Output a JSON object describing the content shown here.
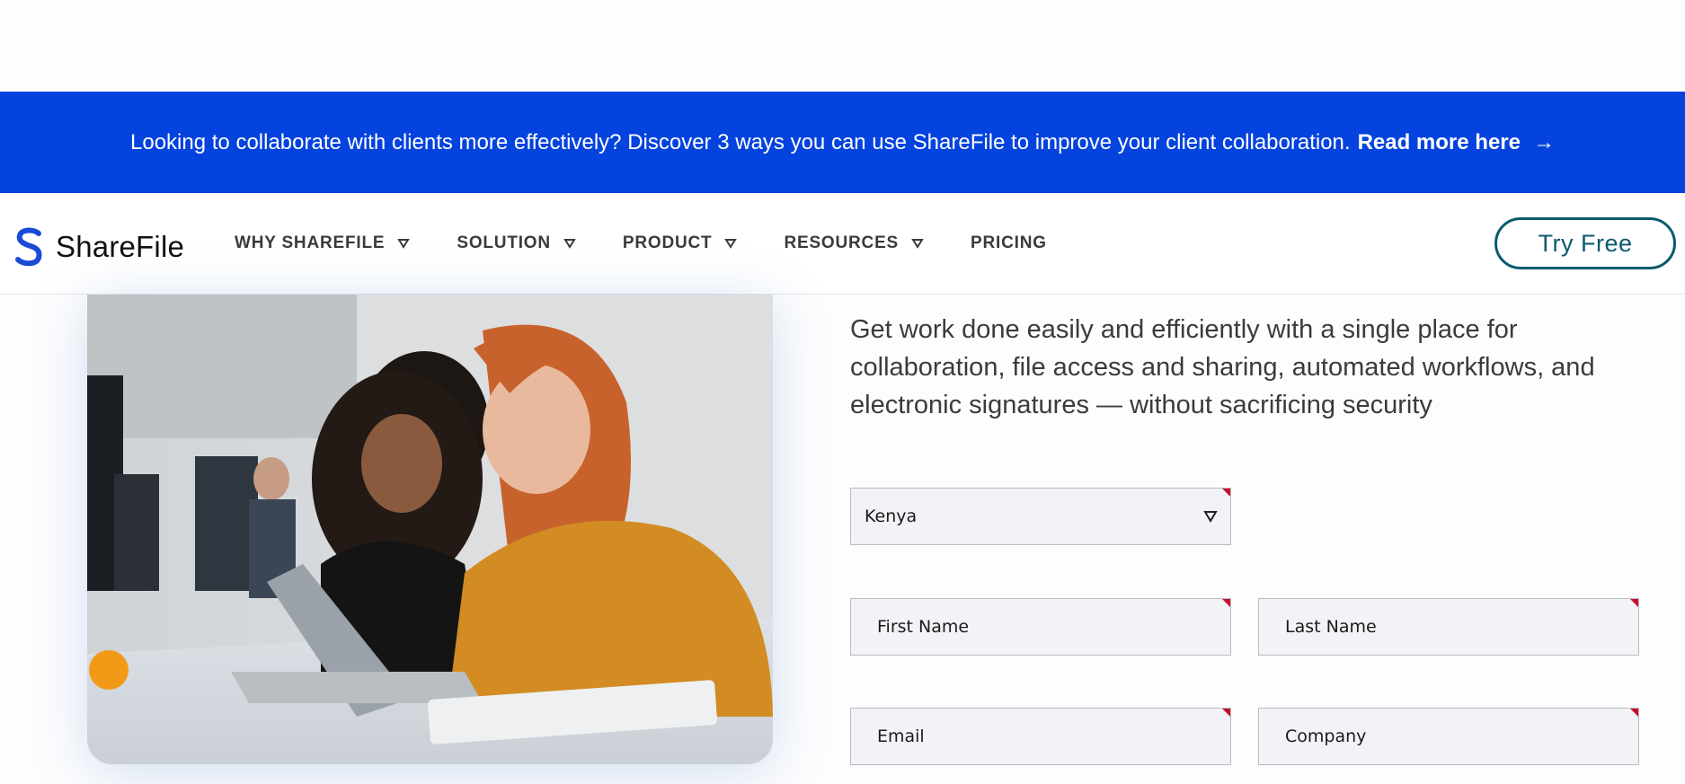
{
  "banner": {
    "message": "Looking to collaborate with clients more effectively? Discover 3 ways you can use ShareFile to improve your client collaboration.",
    "link_label": "Read more here",
    "arrow": "→",
    "background": "#0443dd"
  },
  "brand": {
    "name": "ShareFile",
    "logo_icon": "sharefile-s-icon",
    "accent": "#1a4bd6"
  },
  "nav": {
    "items": [
      {
        "label": "WHY SHAREFILE",
        "has_dropdown": true
      },
      {
        "label": "SOLUTION",
        "has_dropdown": true
      },
      {
        "label": "PRODUCT",
        "has_dropdown": true
      },
      {
        "label": "RESOURCES",
        "has_dropdown": true
      },
      {
        "label": "PRICING",
        "has_dropdown": false
      }
    ],
    "cta_label": "Try Free",
    "cta_color": "#0b5a6e"
  },
  "hero": {
    "intro": "Get work done easily and efficiently with a single place for collaboration, file access and sharing, automated workflows, and electronic signatures — without sacrificing security"
  },
  "form": {
    "country": {
      "selected": "Kenya"
    },
    "first_name": {
      "placeholder": "First Name"
    },
    "last_name": {
      "placeholder": "Last Name"
    },
    "email": {
      "placeholder": "Email"
    },
    "company": {
      "placeholder": "Company"
    },
    "required_marker_color": "#c8102e"
  }
}
